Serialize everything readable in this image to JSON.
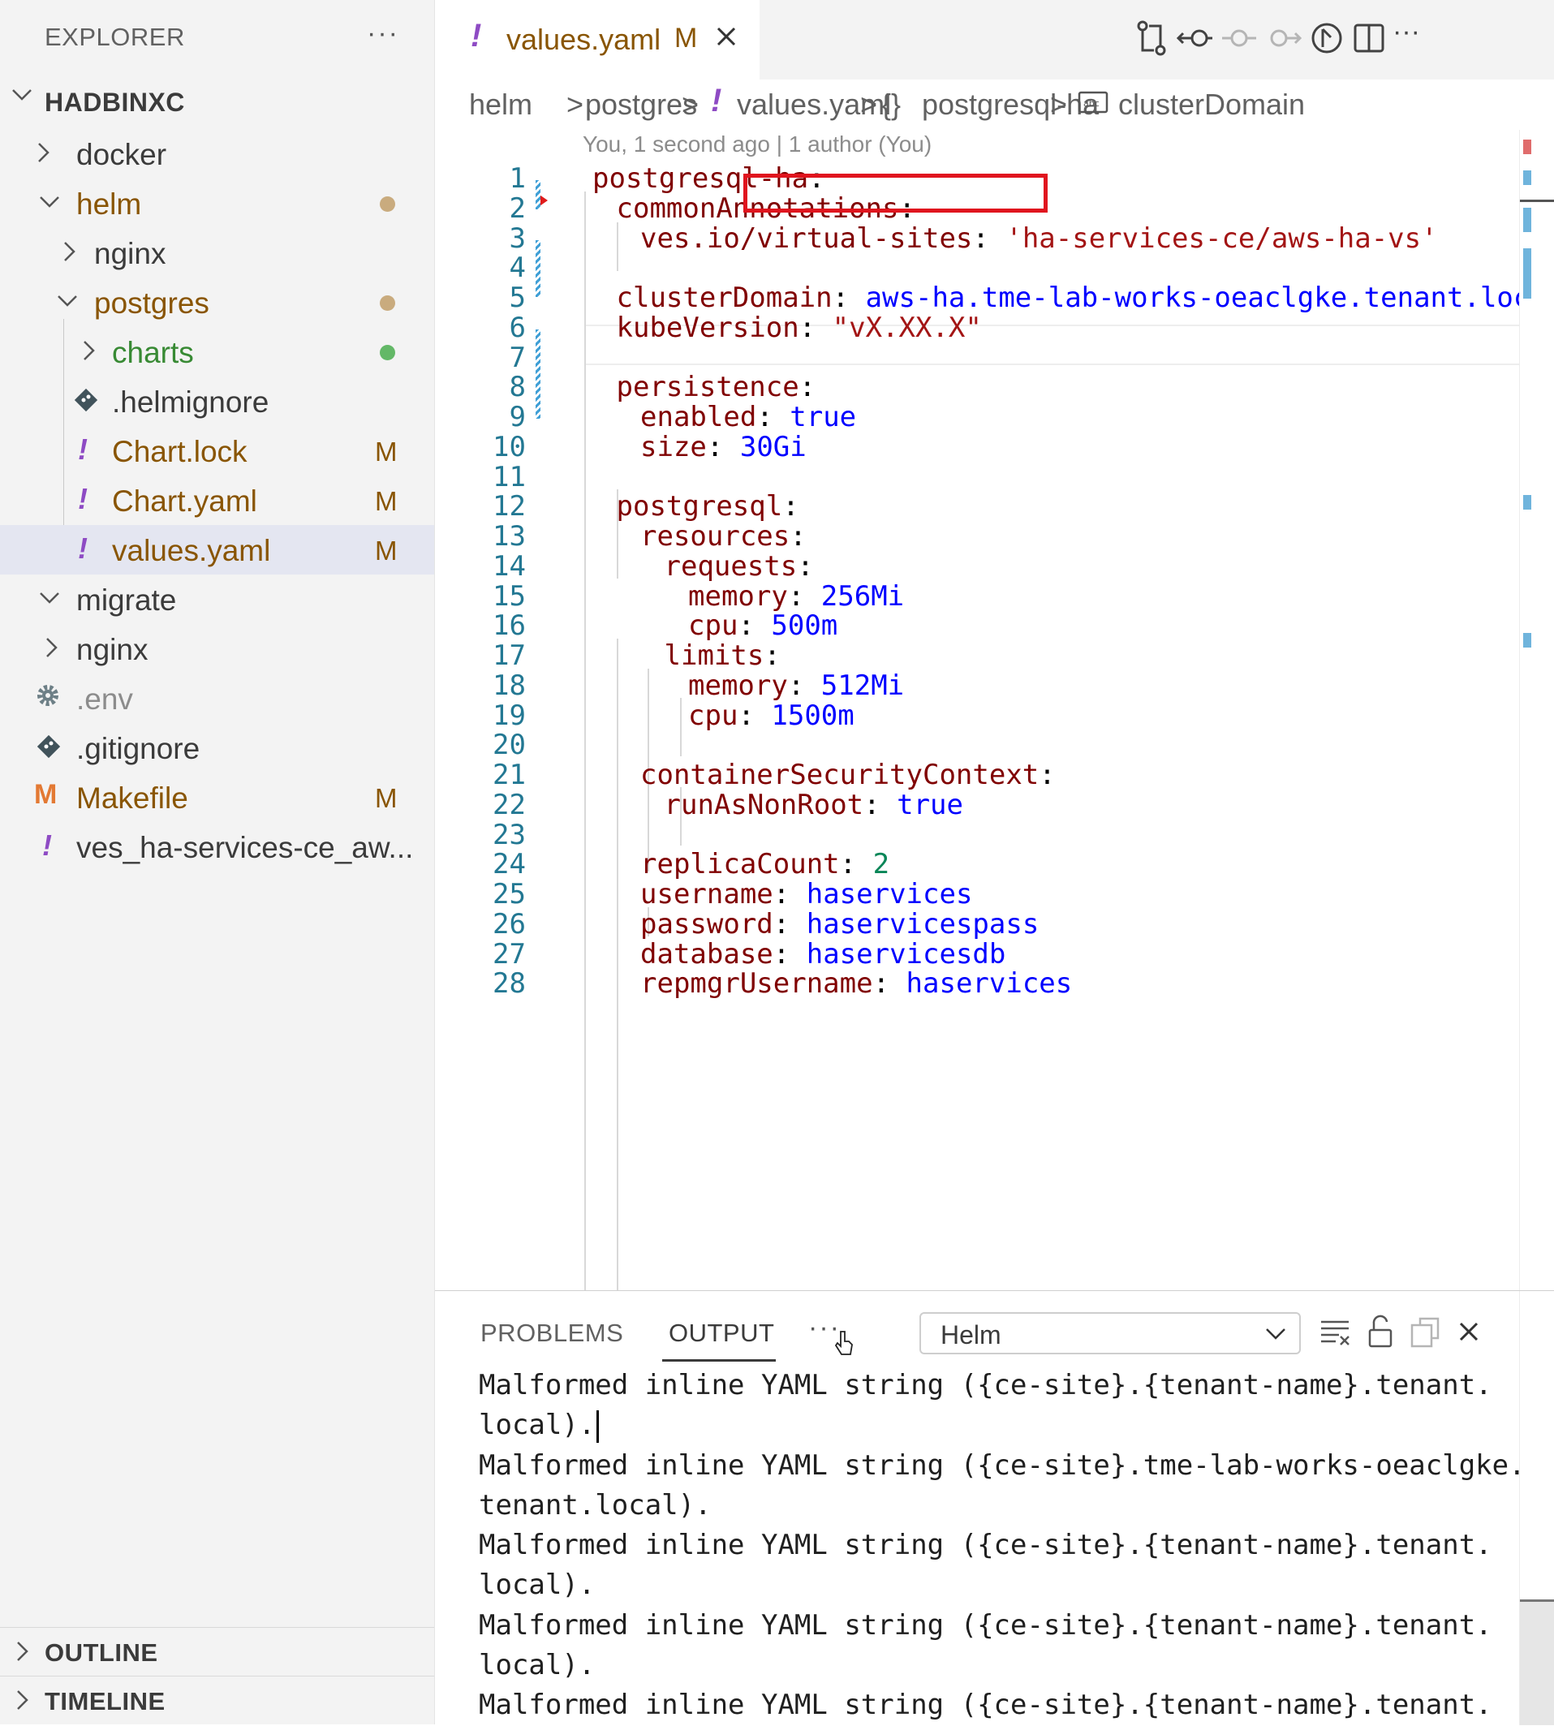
{
  "explorer": {
    "header": "EXPLORER",
    "more": "···",
    "root": "HADBINXC",
    "items": [
      {
        "label": "docker",
        "color": "#3b3b3b"
      },
      {
        "label": "helm",
        "color": "#895503"
      },
      {
        "label": "nginx",
        "color": "#3b3b3b"
      },
      {
        "label": "postgres",
        "color": "#895503"
      },
      {
        "label": "charts",
        "color": "#388a34"
      },
      {
        "label": ".helmignore",
        "color": "#3b3b3b"
      },
      {
        "label": "Chart.lock",
        "color": "#895503",
        "badge": "M"
      },
      {
        "label": "Chart.yaml",
        "color": "#895503",
        "badge": "M"
      },
      {
        "label": "values.yaml",
        "color": "#895503",
        "badge": "M"
      },
      {
        "label": "migrate",
        "color": "#3b3b3b"
      },
      {
        "label": "nginx",
        "color": "#3b3b3b"
      },
      {
        "label": ".env",
        "color": "#8c8c8c"
      },
      {
        "label": ".gitignore",
        "color": "#3b3b3b"
      },
      {
        "label": "Makefile",
        "color": "#895503",
        "badge": "M"
      },
      {
        "label": "ves_ha-services-ce_aw...",
        "color": "#3b3b3b"
      }
    ],
    "outline": "OUTLINE",
    "timeline": "TIMELINE"
  },
  "tab": {
    "name": "values.yaml",
    "modified": "M"
  },
  "breadcrumb": {
    "parts": [
      "helm",
      "postgres",
      "values.yaml",
      "postgresql-ha",
      "clusterDomain"
    ],
    "sep": ">",
    "braces": "{}"
  },
  "blame": "You, 1 second ago | 1 author (You)",
  "editor": {
    "lines": [
      {
        "n": "1",
        "t": [
          [
            "k",
            "postgresql-ha"
          ],
          [
            "p",
            ":"
          ]
        ]
      },
      {
        "n": "2",
        "t": [
          [
            "k",
            "commonAnnotations"
          ],
          [
            "p",
            ":"
          ]
        ]
      },
      {
        "n": "3",
        "t": [
          [
            "k",
            "ves.io/virtual-sites"
          ],
          [
            "p",
            ": "
          ],
          [
            "s",
            "'ha-services-ce/aws-ha-vs'"
          ]
        ]
      },
      {
        "n": "4",
        "t": []
      },
      {
        "n": "5",
        "t": [
          [
            "k",
            "clusterDomain"
          ],
          [
            "p",
            ": "
          ],
          [
            "v",
            "aws-ha.tme-lab-works-oeaclgke.tenant.local"
          ]
        ]
      },
      {
        "n": "6",
        "t": [
          [
            "k",
            "kubeVersion"
          ],
          [
            "p",
            ": "
          ],
          [
            "s",
            "\"vX.XX.X\""
          ]
        ]
      },
      {
        "n": "7",
        "t": []
      },
      {
        "n": "8",
        "t": [
          [
            "k",
            "persistence"
          ],
          [
            "p",
            ":"
          ]
        ]
      },
      {
        "n": "9",
        "t": [
          [
            "k",
            "enabled"
          ],
          [
            "p",
            ": "
          ],
          [
            "v",
            "true"
          ]
        ]
      },
      {
        "n": "10",
        "t": [
          [
            "k",
            "size"
          ],
          [
            "p",
            ": "
          ],
          [
            "v",
            "30Gi"
          ]
        ]
      },
      {
        "n": "11",
        "t": []
      },
      {
        "n": "12",
        "t": [
          [
            "k",
            "postgresql"
          ],
          [
            "p",
            ":"
          ]
        ]
      },
      {
        "n": "13",
        "t": [
          [
            "k",
            "resources"
          ],
          [
            "p",
            ":"
          ]
        ]
      },
      {
        "n": "14",
        "t": [
          [
            "k",
            "requests"
          ],
          [
            "p",
            ":"
          ]
        ]
      },
      {
        "n": "15",
        "t": [
          [
            "k",
            "memory"
          ],
          [
            "p",
            ": "
          ],
          [
            "v",
            "256Mi"
          ]
        ]
      },
      {
        "n": "16",
        "t": [
          [
            "k",
            "cpu"
          ],
          [
            "p",
            ": "
          ],
          [
            "v",
            "500m"
          ]
        ]
      },
      {
        "n": "17",
        "t": [
          [
            "k",
            "limits"
          ],
          [
            "p",
            ":"
          ]
        ]
      },
      {
        "n": "18",
        "t": [
          [
            "k",
            "memory"
          ],
          [
            "p",
            ": "
          ],
          [
            "v",
            "512Mi"
          ]
        ]
      },
      {
        "n": "19",
        "t": [
          [
            "k",
            "cpu"
          ],
          [
            "p",
            ": "
          ],
          [
            "v",
            "1500m"
          ]
        ]
      },
      {
        "n": "20",
        "t": []
      },
      {
        "n": "21",
        "t": [
          [
            "k",
            "containerSecurityContext"
          ],
          [
            "p",
            ":"
          ]
        ]
      },
      {
        "n": "22",
        "t": [
          [
            "k",
            "runAsNonRoot"
          ],
          [
            "p",
            ": "
          ],
          [
            "v",
            "true"
          ]
        ]
      },
      {
        "n": "23",
        "t": []
      },
      {
        "n": "24",
        "t": [
          [
            "k",
            "replicaCount"
          ],
          [
            "p",
            ": "
          ],
          [
            "n",
            "2"
          ]
        ]
      },
      {
        "n": "25",
        "t": [
          [
            "k",
            "username"
          ],
          [
            "p",
            ": "
          ],
          [
            "v",
            "haservices"
          ]
        ]
      },
      {
        "n": "26",
        "t": [
          [
            "k",
            "password"
          ],
          [
            "p",
            ": "
          ],
          [
            "v",
            "haservicespass"
          ]
        ]
      },
      {
        "n": "27",
        "t": [
          [
            "k",
            "database"
          ],
          [
            "p",
            ": "
          ],
          [
            "v",
            "haservicesdb"
          ]
        ]
      },
      {
        "n": "28",
        "t": [
          [
            "k",
            "repmgrUsername"
          ],
          [
            "p",
            ": "
          ],
          [
            "v",
            "haservices"
          ]
        ]
      }
    ]
  },
  "panel": {
    "tabs": [
      "PROBLEMS",
      "OUTPUT"
    ],
    "more": "···",
    "channel": "Helm",
    "output_lines": [
      "Malformed inline YAML string ({ce-site}.{tenant-name}.tenant.",
      "local).",
      "Malformed inline YAML string ({ce-site}.tme-lab-works-oeaclgke.",
      "tenant.local).",
      "Malformed inline YAML string ({ce-site}.{tenant-name}.tenant.",
      "local).",
      "Malformed inline YAML string ({ce-site}.{tenant-name}.tenant.",
      "local).",
      "Malformed inline YAML string ({ce-site}.{tenant-name}.tenant."
    ]
  },
  "colors": {
    "accent_modified": "#895503",
    "untracked_green": "#388a34",
    "yaml_icon": "#8e4bc4",
    "highlight_red": "#e0141e"
  }
}
